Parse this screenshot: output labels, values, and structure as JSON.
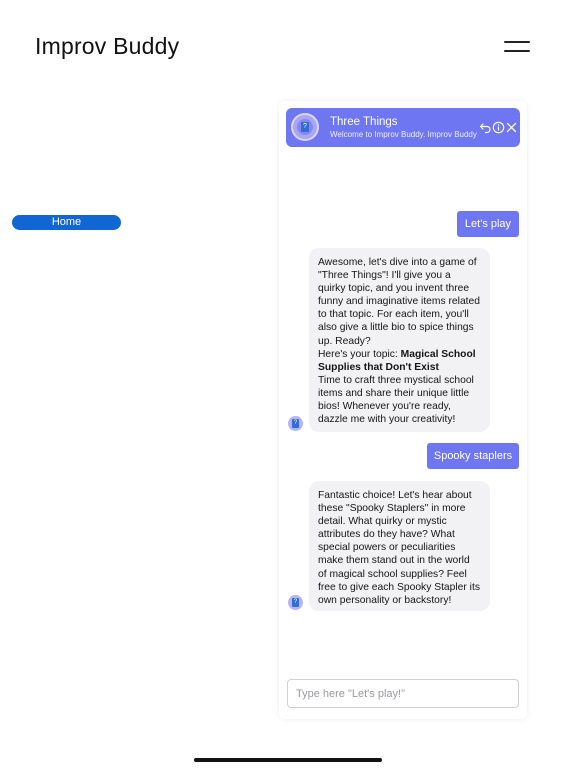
{
  "app": {
    "title": "Improv Buddy"
  },
  "sidebar": {
    "home_label": "Home"
  },
  "chat": {
    "header": {
      "title": "Three Things",
      "subtitle": "Welcome to Improv Buddy. Improv Buddy is here to help you practice improv games!"
    },
    "messages": [
      {
        "role": "user",
        "text": "Let's play"
      },
      {
        "role": "bot",
        "paragraphs": [
          "Awesome, let's dive into a game of \"Three Things\"! I'll give you a quirky topic, and you invent three funny and imaginative items related to that topic. For each item, you'll also give a little bio to spice things up. Ready?"
        ],
        "topic_prefix": "Here's your topic: ",
        "topic": "Magical School Supplies that Don't Exist",
        "closing": "Time to craft three mystical school items and share their unique little bios! Whenever you're ready, dazzle me with your creativity!"
      },
      {
        "role": "user",
        "text": "Spooky staplers"
      },
      {
        "role": "bot",
        "paragraphs": [
          "Fantastic choice! Let's hear about these \"Spooky Staplers\" in more detail. What quirky or mystic attributes do they have? What special powers or peculiarities make them stand out in the world of magical school supplies? Feel free to give each Spooky Stapler its own personality or backstory!"
        ]
      }
    ],
    "input": {
      "value": "",
      "placeholder": "Type here \"Let's play!\""
    }
  },
  "colors": {
    "accent": "#6f76f2",
    "home_button": "#1266d4",
    "bot_bubble": "#f2f2f4"
  },
  "icons": {
    "header_avatar": "question-block-avatar-icon",
    "reset": "undo-arrow-icon",
    "info": "info-circle-icon",
    "close": "close-icon",
    "menu": "hamburger-menu-icon"
  }
}
